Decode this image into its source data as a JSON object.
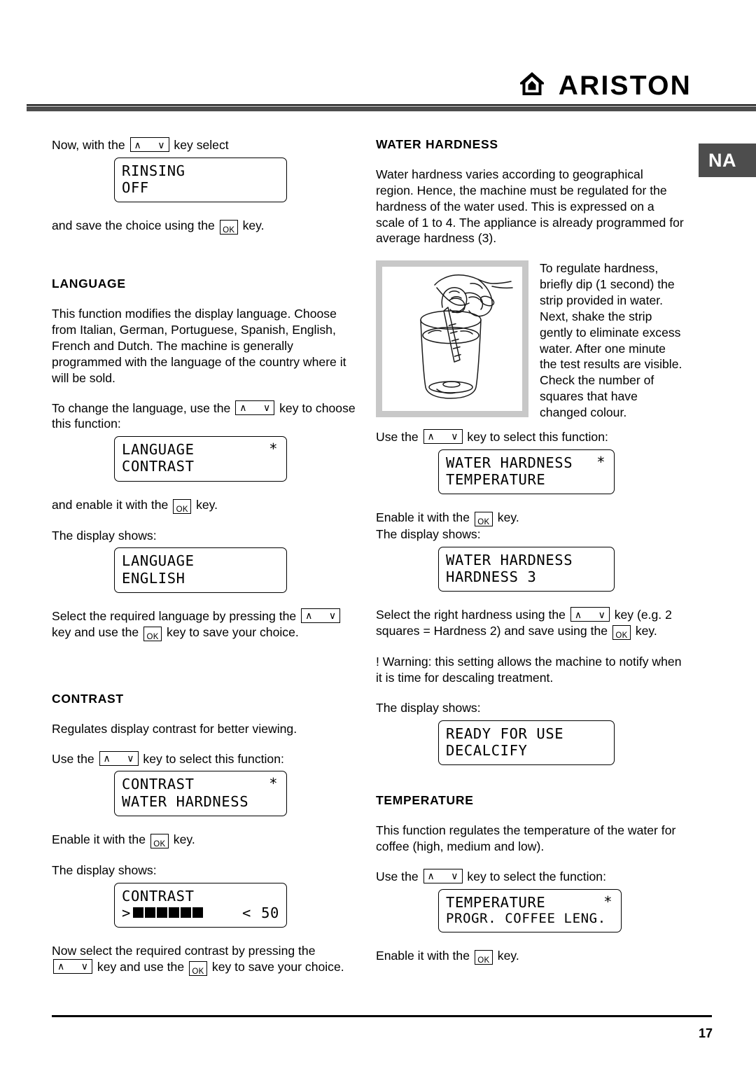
{
  "header": {
    "brand_name": "ARISTON",
    "brand_icon": "home-icon"
  },
  "corner_badge": {
    "label": "NA"
  },
  "left_column": {
    "intro": {
      "text_before_key": "Now, with the",
      "text_after_key": "key select",
      "display": {
        "line1": "RINSING",
        "line2": "OFF"
      },
      "save_before": "and save the choice using the",
      "save_after": "key."
    },
    "language_section": {
      "heading": "LANGUAGE",
      "paragraph": "This function modifies the display language. Choose from Italian, German, Portuguese, Spanish, English, French and Dutch. The machine is generally programmed with the language of the country where it will be sold.",
      "choose_before": "To change the language, use the",
      "choose_after": "key to choose this function:",
      "menu_display": {
        "line1": "LANGUAGE",
        "line2": "CONTRAST",
        "marker": "*"
      },
      "enable_before": "and enable it with the",
      "enable_after": "key.",
      "display_shows": "The display shows:",
      "value_display": {
        "line1": "LANGUAGE",
        "line2": "ENGLISH"
      },
      "select_before": "Select the required language by pressing the",
      "select_middle": "key and use the",
      "select_after": "key to save your choice."
    },
    "contrast_section": {
      "heading": "CONTRAST",
      "paragraph": "Regulates display contrast for better viewing.",
      "use_before": "Use the",
      "use_after": "key to select this function:",
      "menu_display": {
        "line1": "CONTRAST",
        "line2": "WATER HARDNESS",
        "marker": "*"
      },
      "enable_before": "Enable it with the",
      "enable_after": "key.",
      "display_shows": "The display shows:",
      "value_display": {
        "line1": "CONTRAST",
        "left_arrow": ">",
        "blocks_filled": 6,
        "right_arrow": "<",
        "value": "50"
      },
      "now_select_before": "Now select the required contrast by pressing the",
      "now_select_middle": "key and use the",
      "now_select_after": "key to save your choice."
    }
  },
  "right_column": {
    "water_hardness_section": {
      "heading": "WATER HARDNESS",
      "paragraph1": "Water hardness varies according to geographical region. Hence, the machine must be regulated for the hardness of the water used. This is expressed on a scale of 1 to 4. The appliance is already programmed for average hardness (3).",
      "illustration_caption": "To regulate hardness, briefly dip (1 second) the strip provided in water. Next, shake the strip gently to eliminate excess water. After one minute the test results are visible. Check the number of squares that have changed colour.",
      "illustration_name": "hand-dipping-test-strip-in-glass",
      "use_before": "Use the",
      "use_after": "key to select this function:",
      "menu_display": {
        "line1": "WATER HARDNESS",
        "line2": "TEMPERATURE",
        "marker": "*"
      },
      "enable_before": "Enable it with the",
      "enable_after": "key.",
      "display_shows": "The display shows:",
      "value_display": {
        "line1": "WATER HARDNESS",
        "line2": "HARDNESS 3"
      },
      "select_before": "Select the right hardness using the",
      "select_after": "key (e.g. 2 squares = Hardness 2) and save using the",
      "select_end": "key.",
      "warning": "! Warning: this setting allows the machine to notify when it is time for descaling treatment.",
      "display_shows2": "The display shows:",
      "ready_display": {
        "line1": "READY FOR USE",
        "line2": "DECALCIFY"
      }
    },
    "temperature_section": {
      "heading": "TEMPERATURE",
      "paragraph": "This function regulates the temperature of the water for coffee (high, medium and low).",
      "use_before": "Use the",
      "use_after": "key to select the function:",
      "menu_display": {
        "line1": "TEMPERATURE",
        "line2": "PROGR. COFFEE LENG.",
        "marker": "*"
      },
      "enable_before": "Enable it with the",
      "enable_after": "key."
    }
  },
  "footer": {
    "page_number": "17"
  },
  "keys": {
    "up_glyph": "∧",
    "down_glyph": "∨",
    "ok_label": "OK"
  }
}
